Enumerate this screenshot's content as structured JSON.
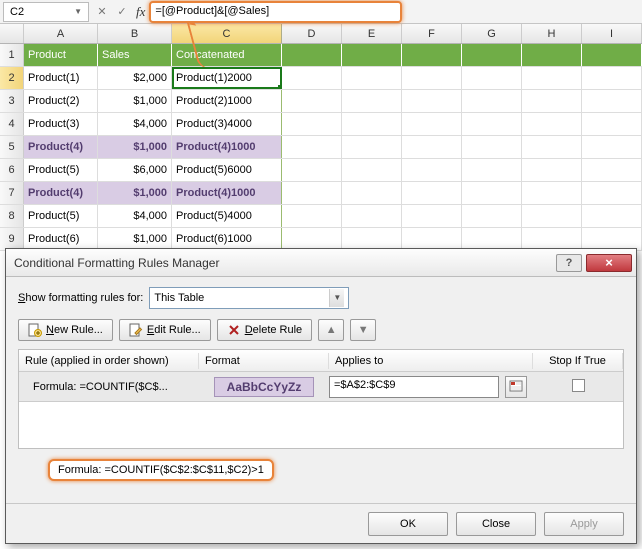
{
  "formula_bar": {
    "cell_ref": "C2",
    "formula": "=[@Product]&[@Sales]"
  },
  "columns": [
    "A",
    "B",
    "C",
    "D",
    "E",
    "F",
    "G",
    "H",
    "I"
  ],
  "rows": [
    "1",
    "2",
    "3",
    "4",
    "5",
    "6",
    "7",
    "8",
    "9"
  ],
  "headers": {
    "a": "Product",
    "b": "Sales",
    "c": "Concatenated"
  },
  "data": [
    {
      "product": "Product(1)",
      "sales": "$2,000",
      "concat": "Product(1)2000",
      "dup": false
    },
    {
      "product": "Product(2)",
      "sales": "$1,000",
      "concat": "Product(2)1000",
      "dup": false
    },
    {
      "product": "Product(3)",
      "sales": "$4,000",
      "concat": "Product(3)4000",
      "dup": false
    },
    {
      "product": "Product(4)",
      "sales": "$1,000",
      "concat": "Product(4)1000",
      "dup": true
    },
    {
      "product": "Product(5)",
      "sales": "$6,000",
      "concat": "Product(5)6000",
      "dup": false
    },
    {
      "product": "Product(4)",
      "sales": "$1,000",
      "concat": "Product(4)1000",
      "dup": true
    },
    {
      "product": "Product(5)",
      "sales": "$4,000",
      "concat": "Product(5)4000",
      "dup": false
    },
    {
      "product": "Product(6)",
      "sales": "$1,000",
      "concat": "Product(6)1000",
      "dup": false
    }
  ],
  "dialog": {
    "title": "Conditional Formatting Rules Manager",
    "show_for_label": "Show formatting rules for:",
    "show_for_value": "This Table",
    "buttons": {
      "new": "New Rule...",
      "edit": "Edit Rule...",
      "delete": "Delete Rule"
    },
    "list_headers": {
      "rule": "Rule (applied in order shown)",
      "format": "Format",
      "applies": "Applies to",
      "stop": "Stop If True"
    },
    "rule": {
      "name": "Formula: =COUNTIF($C$...",
      "format_sample": "AaBbCcYyZz",
      "applies_to": "=$A$2:$C$9"
    },
    "callout": "Formula: =COUNTIF($C$2:$C$11,$C2)>1",
    "footer": {
      "ok": "OK",
      "close": "Close",
      "apply": "Apply"
    }
  }
}
